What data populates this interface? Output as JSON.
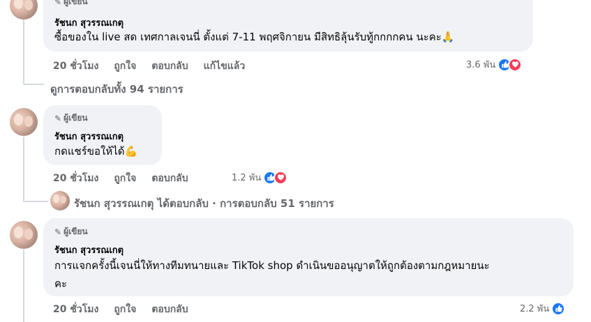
{
  "comments": [
    {
      "badge": "ผู้เขียน",
      "author": "รัชนก สุวรรณเกตุ",
      "text": "ซื้อของใน live สด เทศกาลเจนนี่ ตั้งแต่ 7-11 พฤศจิกายน มีสิทธิลุ้นรับทู้กกกกคน นะคะ🙏",
      "time": "20 ชั่วโมง",
      "like": "ถูกใจ",
      "reply": "ตอบกลับ",
      "edited": "แก้ไขแล้ว",
      "reaction_count": "3.6 พัน",
      "reactions": [
        "like",
        "love"
      ]
    },
    {
      "badge": "ผู้เขียน",
      "author": "รัชนก สุวรรณเกตุ",
      "text": "กดแชร์ขอให้ได้💪",
      "time": "20 ชั่วโมง",
      "like": "ถูกใจ",
      "reply": "ตอบกลับ",
      "reaction_count": "1.2 พัน",
      "reactions": [
        "like",
        "love"
      ]
    },
    {
      "badge": "ผู้เขียน",
      "author": "รัชนก สุวรรณเกตุ",
      "text_line1": "การแจกครั้งนี้เจนนี่ให้ทางทีมทนายและ TikTok shop ดำเนินขออนุญาตให้ถูกต้องตามกฎหมายนะ",
      "text_line2": "คะ",
      "time": "20 ชั่วโมง",
      "like": "ถูกใจ",
      "reply": "ตอบกลับ",
      "reaction_count": "2.2 พัน",
      "reactions": [
        "like"
      ]
    }
  ],
  "view_replies_1": "ดูการตอบกลับทั้ง 94 รายการ",
  "reply_summary_2": "รัชนก สุวรรณเกตุ ได้ตอบกลับ · การตอบกลับ 51 รายการ",
  "colors": {
    "like": "#1877f2",
    "love": "#f33e58",
    "bubble": "#f0f2f5",
    "meta": "#65676b"
  }
}
